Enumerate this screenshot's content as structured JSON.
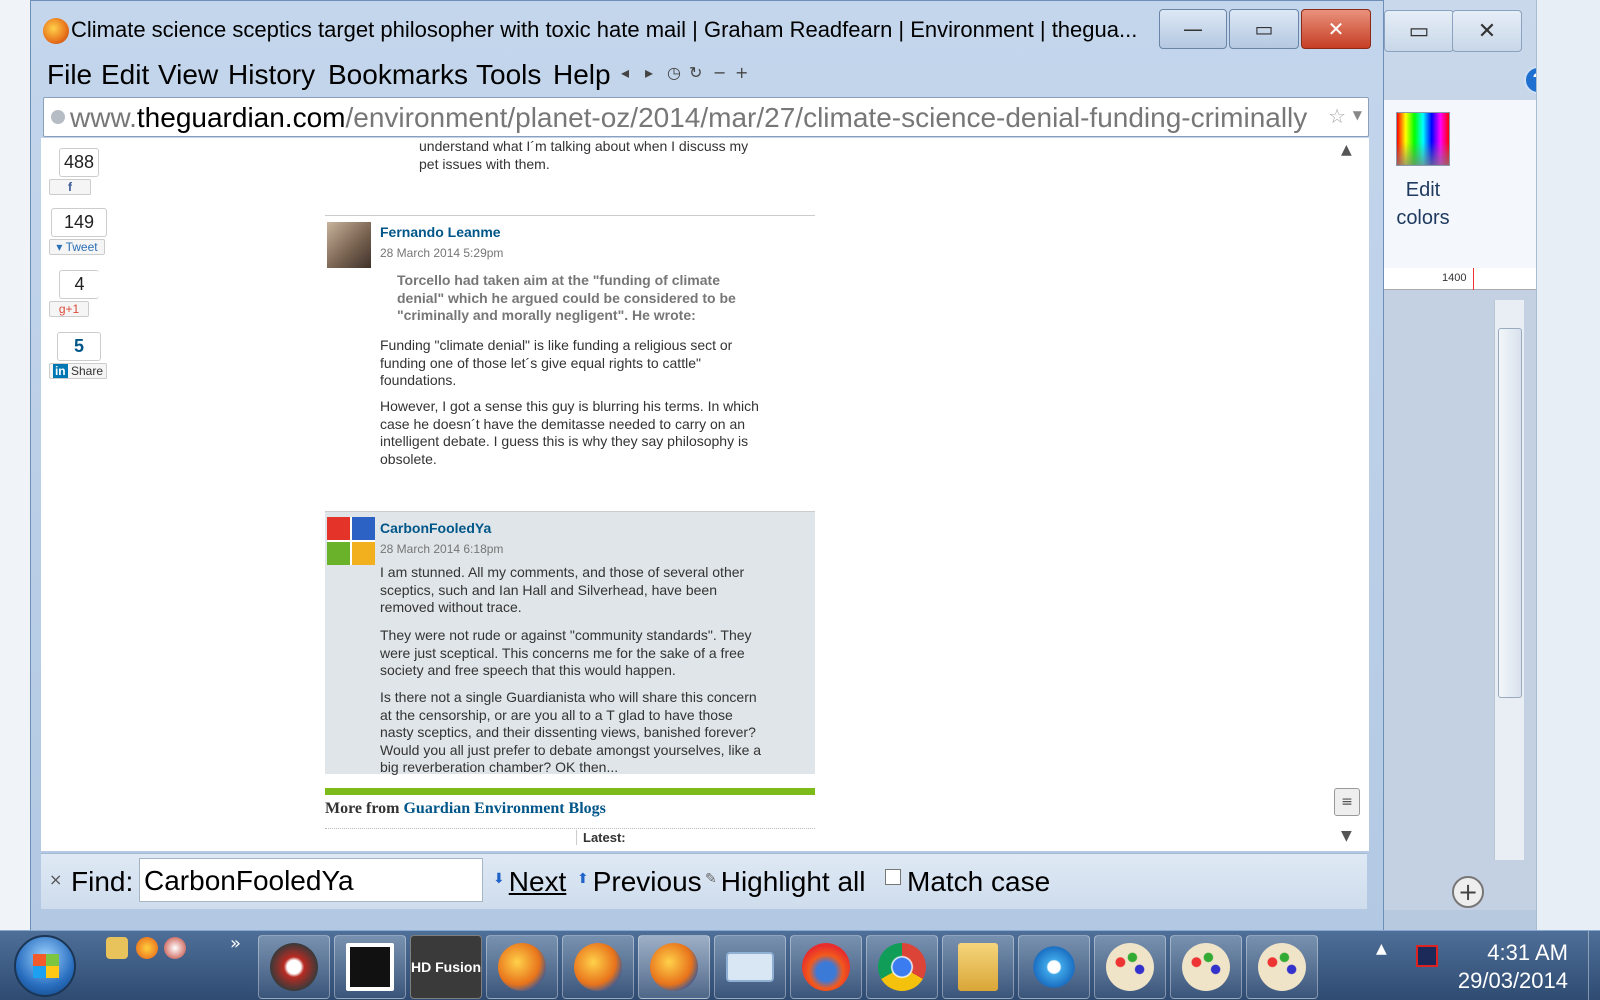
{
  "window": {
    "title": "Climate science sceptics target philosopher with toxic hate mail | Graham Readfearn | Environment | thegua...",
    "minimize_glyph": "—",
    "maximize_glyph": "▭",
    "close_glyph": "✕"
  },
  "menu": {
    "file": "File",
    "edit": "Edit",
    "view": "View",
    "history": "History",
    "bookmarks": "Bookmarks",
    "tools": "Tools",
    "help": "Help"
  },
  "urlbar": {
    "prefix": "www.",
    "domain": "theguardian.com",
    "path": "/environment/planet-oz/2014/mar/27/climate-science-denial-funding-criminally"
  },
  "share": {
    "facebook_count": "488",
    "facebook_label": "f",
    "twitter_count": "149",
    "twitter_label": "Tweet",
    "gplus_count": "4",
    "gplus_label": "g+1",
    "linkedin_count": "5",
    "linkedin_label": "Share"
  },
  "prev_comment_tail": "understand what I´m talking about when I discuss my pet issues with them.",
  "comments": [
    {
      "author": "Fernando Leanme",
      "time": "28 March 2014 5:29pm",
      "quote": "Torcello had taken aim at the \"funding of climate denial\" which he argued could be considered to be \"criminally and morally negligent\". He wrote:",
      "paragraphs": [
        "Funding \"climate denial\" is like funding a religious sect or funding one of those let´s give equal rights to cattle\" foundations.",
        "However, I got a sense this guy is blurring his terms. In which case he doesn´t have the demitasse needed to carry on an intelligent debate. I guess this is why they say philosophy is obsolete."
      ]
    },
    {
      "author": "CarbonFooledYa",
      "time": "28 March 2014 6:18pm",
      "paragraphs": [
        "I am stunned. All my comments, and those of several other sceptics, such and Ian Hall and Silverhead, have been removed without trace.",
        "They were not rude or against \"community standards\". They were just sceptical. This concerns me for the sake of a free society and free speech that this would happen.",
        "Is there not a single Guardianista who will share this concern at the censorship, or are you all to a T glad to have those nasty sceptics, and their dissenting views, banished forever? Would you all just prefer to debate amongst yourselves, like a big reverberation chamber? OK then..."
      ]
    }
  ],
  "more": {
    "prefix": "More from",
    "link": "Guardian Environment Blogs",
    "latest": "Latest:"
  },
  "findbar": {
    "label": "Find:",
    "value": "CarbonFooledYa",
    "next": "Next",
    "previous": "Previous",
    "highlight_all": "Highlight all",
    "match_case": "Match case"
  },
  "paint": {
    "edit_colors": "Edit colors",
    "ruler_value": "1400"
  },
  "taskbar": {
    "hd_fusion": "HD Fusion",
    "time": "4:31 AM",
    "date": "29/03/2014"
  },
  "colors": {
    "guardian_blue": "#005689",
    "highlight_bg": "#dfe5e8",
    "green_rule": "#7dbb1a"
  }
}
